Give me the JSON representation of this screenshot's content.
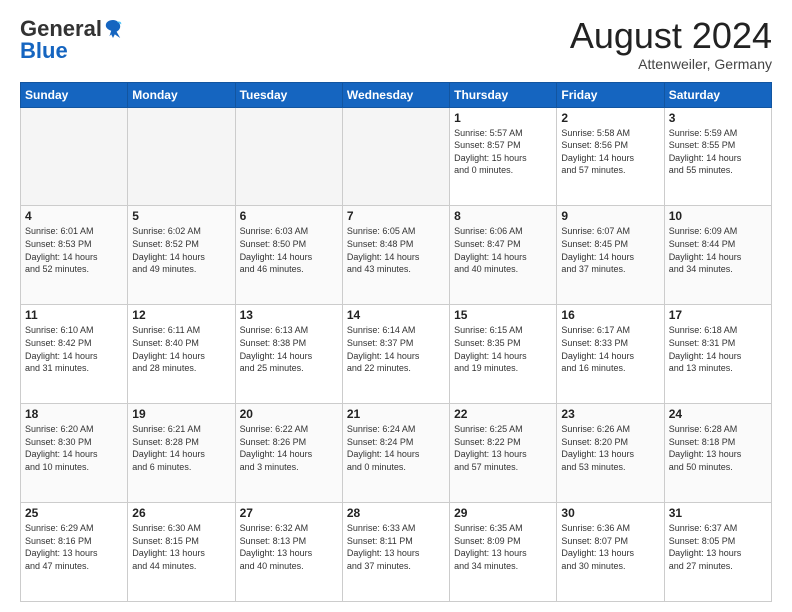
{
  "header": {
    "logo_general": "General",
    "logo_blue": "Blue",
    "month_title": "August 2024",
    "location": "Attenweiler, Germany"
  },
  "days_of_week": [
    "Sunday",
    "Monday",
    "Tuesday",
    "Wednesday",
    "Thursday",
    "Friday",
    "Saturday"
  ],
  "weeks": [
    [
      {
        "num": "",
        "detail": ""
      },
      {
        "num": "",
        "detail": ""
      },
      {
        "num": "",
        "detail": ""
      },
      {
        "num": "",
        "detail": ""
      },
      {
        "num": "1",
        "detail": "Sunrise: 5:57 AM\nSunset: 8:57 PM\nDaylight: 15 hours\nand 0 minutes."
      },
      {
        "num": "2",
        "detail": "Sunrise: 5:58 AM\nSunset: 8:56 PM\nDaylight: 14 hours\nand 57 minutes."
      },
      {
        "num": "3",
        "detail": "Sunrise: 5:59 AM\nSunset: 8:55 PM\nDaylight: 14 hours\nand 55 minutes."
      }
    ],
    [
      {
        "num": "4",
        "detail": "Sunrise: 6:01 AM\nSunset: 8:53 PM\nDaylight: 14 hours\nand 52 minutes."
      },
      {
        "num": "5",
        "detail": "Sunrise: 6:02 AM\nSunset: 8:52 PM\nDaylight: 14 hours\nand 49 minutes."
      },
      {
        "num": "6",
        "detail": "Sunrise: 6:03 AM\nSunset: 8:50 PM\nDaylight: 14 hours\nand 46 minutes."
      },
      {
        "num": "7",
        "detail": "Sunrise: 6:05 AM\nSunset: 8:48 PM\nDaylight: 14 hours\nand 43 minutes."
      },
      {
        "num": "8",
        "detail": "Sunrise: 6:06 AM\nSunset: 8:47 PM\nDaylight: 14 hours\nand 40 minutes."
      },
      {
        "num": "9",
        "detail": "Sunrise: 6:07 AM\nSunset: 8:45 PM\nDaylight: 14 hours\nand 37 minutes."
      },
      {
        "num": "10",
        "detail": "Sunrise: 6:09 AM\nSunset: 8:44 PM\nDaylight: 14 hours\nand 34 minutes."
      }
    ],
    [
      {
        "num": "11",
        "detail": "Sunrise: 6:10 AM\nSunset: 8:42 PM\nDaylight: 14 hours\nand 31 minutes."
      },
      {
        "num": "12",
        "detail": "Sunrise: 6:11 AM\nSunset: 8:40 PM\nDaylight: 14 hours\nand 28 minutes."
      },
      {
        "num": "13",
        "detail": "Sunrise: 6:13 AM\nSunset: 8:38 PM\nDaylight: 14 hours\nand 25 minutes."
      },
      {
        "num": "14",
        "detail": "Sunrise: 6:14 AM\nSunset: 8:37 PM\nDaylight: 14 hours\nand 22 minutes."
      },
      {
        "num": "15",
        "detail": "Sunrise: 6:15 AM\nSunset: 8:35 PM\nDaylight: 14 hours\nand 19 minutes."
      },
      {
        "num": "16",
        "detail": "Sunrise: 6:17 AM\nSunset: 8:33 PM\nDaylight: 14 hours\nand 16 minutes."
      },
      {
        "num": "17",
        "detail": "Sunrise: 6:18 AM\nSunset: 8:31 PM\nDaylight: 14 hours\nand 13 minutes."
      }
    ],
    [
      {
        "num": "18",
        "detail": "Sunrise: 6:20 AM\nSunset: 8:30 PM\nDaylight: 14 hours\nand 10 minutes."
      },
      {
        "num": "19",
        "detail": "Sunrise: 6:21 AM\nSunset: 8:28 PM\nDaylight: 14 hours\nand 6 minutes."
      },
      {
        "num": "20",
        "detail": "Sunrise: 6:22 AM\nSunset: 8:26 PM\nDaylight: 14 hours\nand 3 minutes."
      },
      {
        "num": "21",
        "detail": "Sunrise: 6:24 AM\nSunset: 8:24 PM\nDaylight: 14 hours\nand 0 minutes."
      },
      {
        "num": "22",
        "detail": "Sunrise: 6:25 AM\nSunset: 8:22 PM\nDaylight: 13 hours\nand 57 minutes."
      },
      {
        "num": "23",
        "detail": "Sunrise: 6:26 AM\nSunset: 8:20 PM\nDaylight: 13 hours\nand 53 minutes."
      },
      {
        "num": "24",
        "detail": "Sunrise: 6:28 AM\nSunset: 8:18 PM\nDaylight: 13 hours\nand 50 minutes."
      }
    ],
    [
      {
        "num": "25",
        "detail": "Sunrise: 6:29 AM\nSunset: 8:16 PM\nDaylight: 13 hours\nand 47 minutes."
      },
      {
        "num": "26",
        "detail": "Sunrise: 6:30 AM\nSunset: 8:15 PM\nDaylight: 13 hours\nand 44 minutes."
      },
      {
        "num": "27",
        "detail": "Sunrise: 6:32 AM\nSunset: 8:13 PM\nDaylight: 13 hours\nand 40 minutes."
      },
      {
        "num": "28",
        "detail": "Sunrise: 6:33 AM\nSunset: 8:11 PM\nDaylight: 13 hours\nand 37 minutes."
      },
      {
        "num": "29",
        "detail": "Sunrise: 6:35 AM\nSunset: 8:09 PM\nDaylight: 13 hours\nand 34 minutes."
      },
      {
        "num": "30",
        "detail": "Sunrise: 6:36 AM\nSunset: 8:07 PM\nDaylight: 13 hours\nand 30 minutes."
      },
      {
        "num": "31",
        "detail": "Sunrise: 6:37 AM\nSunset: 8:05 PM\nDaylight: 13 hours\nand 27 minutes."
      }
    ]
  ]
}
